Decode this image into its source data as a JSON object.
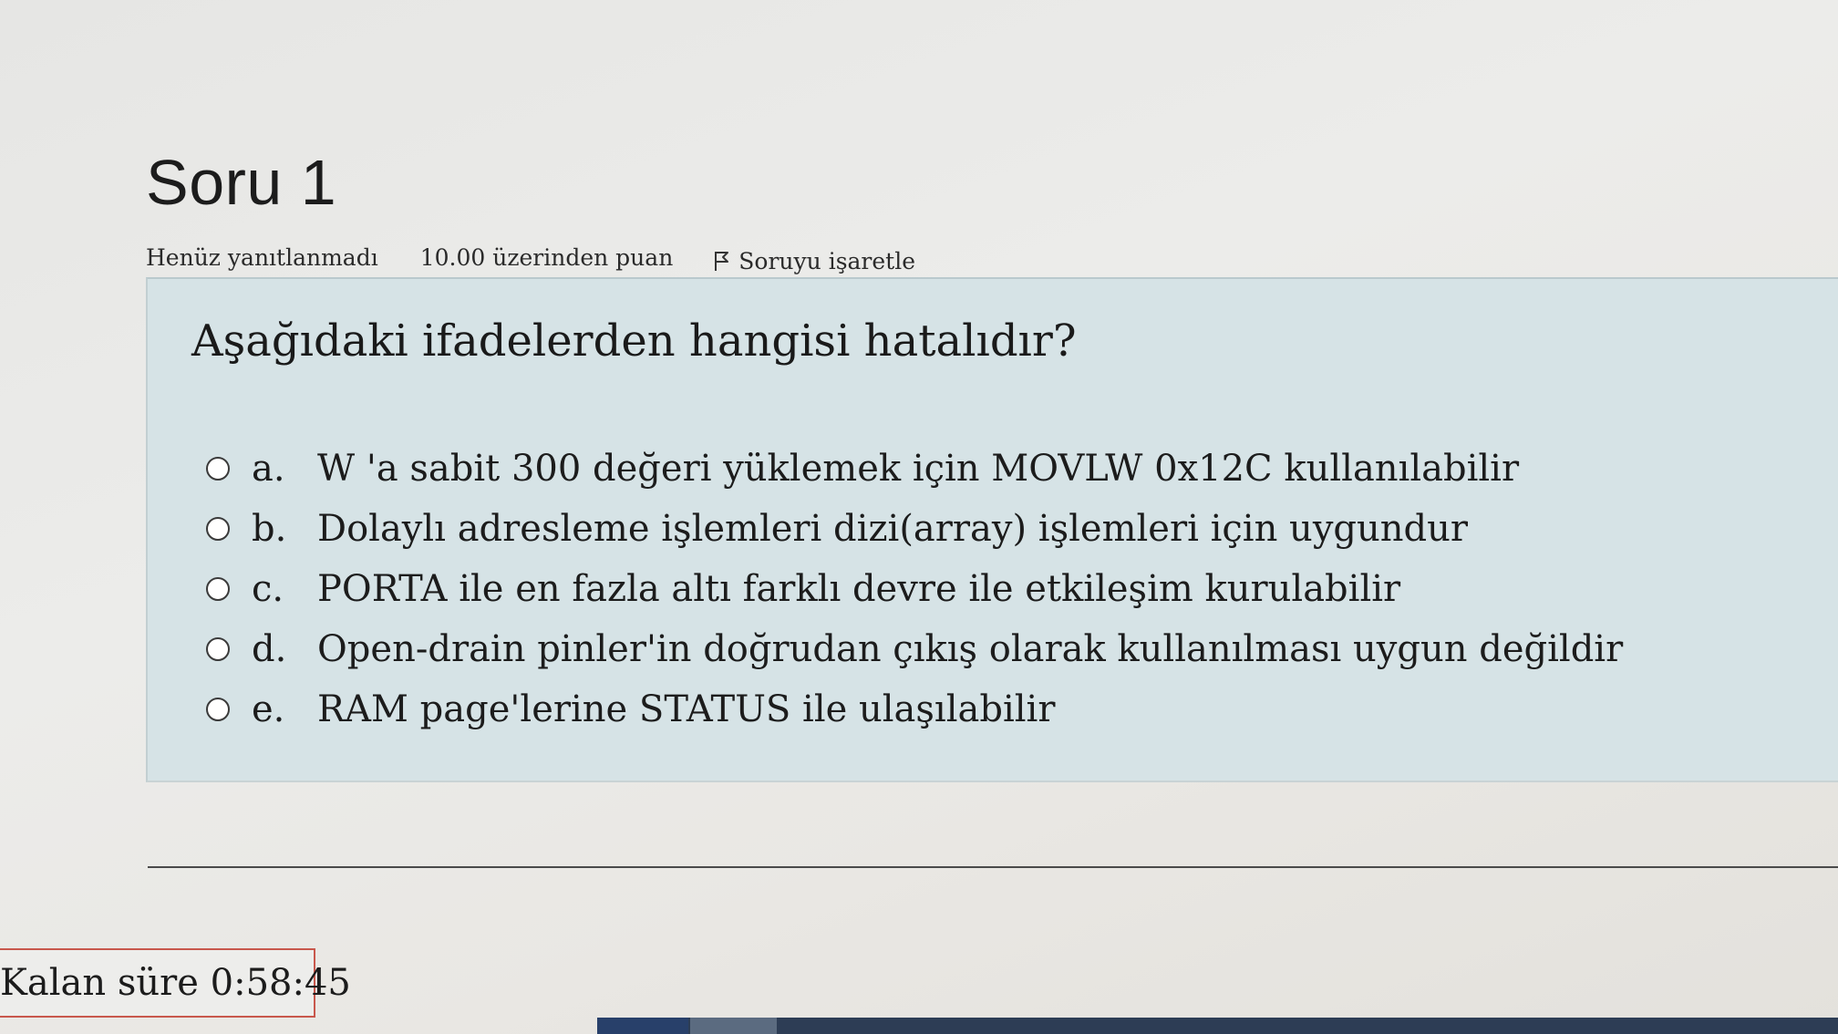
{
  "header": {
    "title": "Soru 1",
    "status": "Henüz yanıtlanmadı",
    "points": "10.00 üzerinden puan",
    "flag_label": "Soruyu işaretle"
  },
  "question": {
    "text": "Aşağıdaki ifadelerden hangisi hatalıdır?",
    "answers": [
      {
        "letter": "a.",
        "text": "W 'a sabit 300 değeri yüklemek için MOVLW 0x12C kullanılabilir"
      },
      {
        "letter": "b.",
        "text": "Dolaylı adresleme işlemleri dizi(array) işlemleri için uygundur"
      },
      {
        "letter": "c.",
        "text": "PORTA ile en fazla altı farklı devre ile etkileşim kurulabilir"
      },
      {
        "letter": "d.",
        "text": "Open-drain pinler'in doğrudan çıkış olarak kullanılması uygun değildir"
      },
      {
        "letter": "e.",
        "text": "RAM page'lerine STATUS ile ulaşılabilir"
      }
    ]
  },
  "timer": {
    "label": "Kalan süre 0:58:45"
  },
  "colors": {
    "question_bg": "#d6e3e6",
    "timer_border": "#c8574c",
    "taskbar": "#2d3d55"
  },
  "icons": {
    "flag": "flag-icon",
    "radio": "radio-unchecked-icon"
  }
}
